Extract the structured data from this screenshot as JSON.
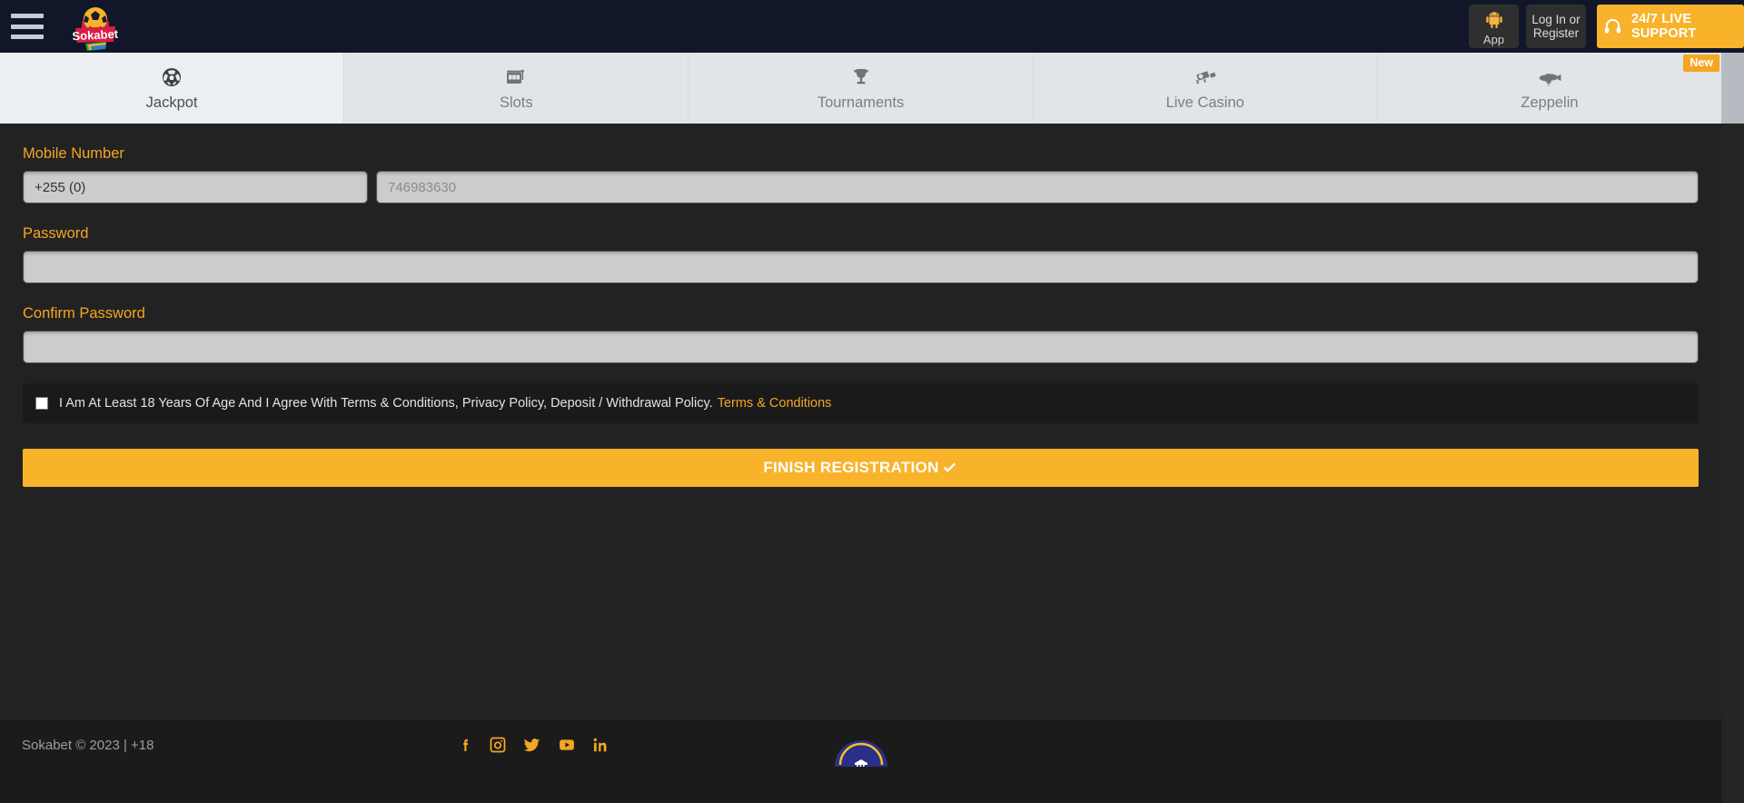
{
  "header": {
    "menu_icon": "hamburger-menu-icon",
    "logo_text": "Sokabet",
    "app_button": {
      "label": "App",
      "icon": "android-icon"
    },
    "login_button": {
      "line1": "Log In or",
      "line2": "Register"
    },
    "support_button": {
      "label": "24/7 LIVE SUPPORT",
      "icon": "headset-icon"
    },
    "bg_color": "#111729"
  },
  "nav": {
    "items": [
      {
        "label": "Jackpot",
        "icon": "soccer-ball-icon",
        "active": true,
        "badge": ""
      },
      {
        "label": "Slots",
        "icon": "slot-machine-icon",
        "active": false,
        "badge": ""
      },
      {
        "label": "Tournaments",
        "icon": "trophy-icon",
        "active": false,
        "badge": ""
      },
      {
        "label": "Live Casino",
        "icon": "video-camera-icon",
        "active": false,
        "badge": ""
      },
      {
        "label": "Zeppelin",
        "icon": "zeppelin-icon",
        "active": false,
        "badge": "New"
      }
    ]
  },
  "form": {
    "mobile": {
      "label": "Mobile Number",
      "prefix_value": "+255 (0)",
      "number_value": "",
      "number_placeholder": "746983630"
    },
    "password": {
      "label": "Password",
      "value": "",
      "placeholder": ""
    },
    "confirm_password": {
      "label": "Confirm Password",
      "value": "",
      "placeholder": ""
    },
    "terms": {
      "checked": false,
      "text": "I Am At Least 18 Years Of Age And I Agree With Terms & Conditions, Privacy Policy, Deposit / Withdrawal Policy.",
      "link_label": "Terms & Conditions"
    },
    "submit_button": {
      "label": "FINISH REGISTRATION",
      "icon": "check-icon"
    }
  },
  "footer": {
    "copyright": "Sokabet © 2023 | +18",
    "socials": [
      {
        "name": "facebook-icon"
      },
      {
        "name": "instagram-icon"
      },
      {
        "name": "twitter-icon"
      },
      {
        "name": "youtube-icon"
      },
      {
        "name": "linkedin-icon"
      }
    ],
    "seal": "gaming-board-seal-icon"
  },
  "colors": {
    "accent": "#f5a623",
    "accent_button": "#f8b32b",
    "header_bg": "#111729",
    "page_bg": "#222222",
    "input_bg": "#cccccc",
    "nav_active_bg": "#eceff1",
    "nav_bg": "#e1e5e8"
  }
}
